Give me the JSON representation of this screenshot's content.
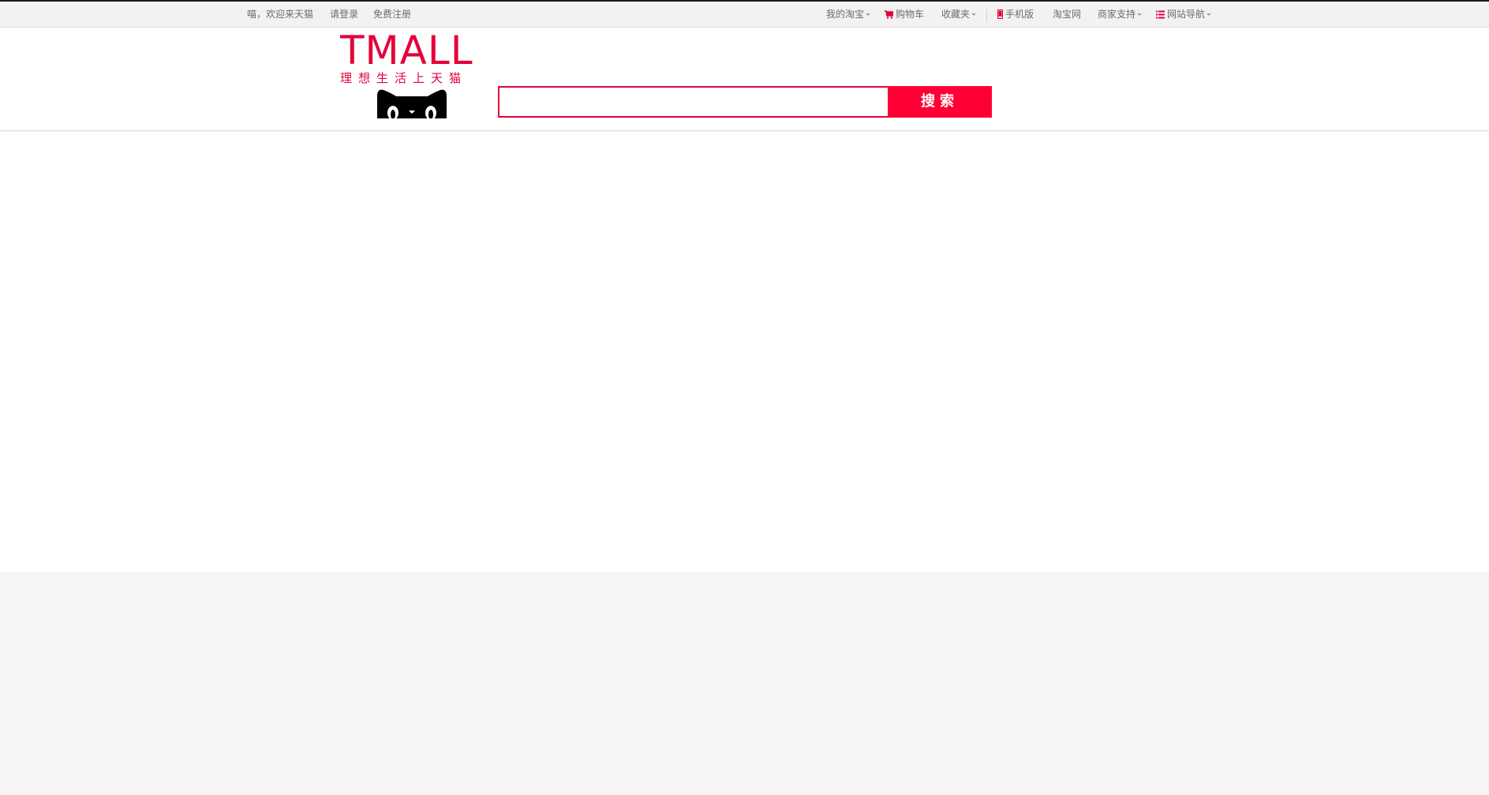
{
  "topnav": {
    "welcome": "喵，欢迎来天猫",
    "login": "请登录",
    "register": "免费注册",
    "my_taobao": "我的淘宝",
    "cart": "购物车",
    "favorites": "收藏夹",
    "mobile": "手机版",
    "taobao": "淘宝网",
    "merchant_support": "商家支持",
    "site_nav": "网站导航"
  },
  "logo": {
    "text": "TMALL",
    "slogan": "理想生活上天猫"
  },
  "search": {
    "value": "",
    "button_label": "搜索"
  },
  "colors": {
    "brand": "#e4003a",
    "button": "#ff0036",
    "nav_bg": "#f2f2f2"
  },
  "icons": [
    "cart-icon",
    "phone-icon",
    "list-icon",
    "cat-logo-icon"
  ]
}
